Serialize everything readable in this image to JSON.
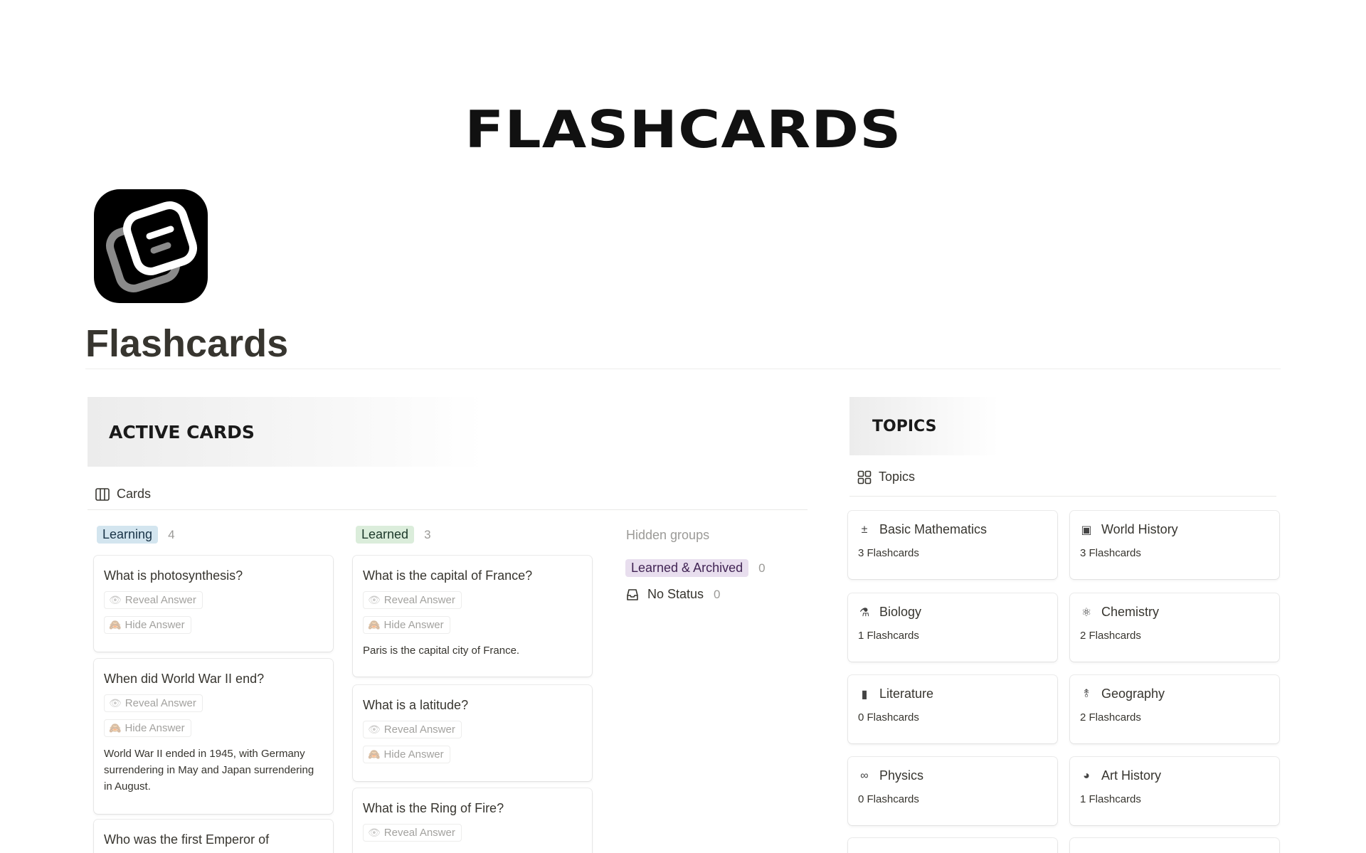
{
  "banner": {
    "title": "FLASHCARDS"
  },
  "page": {
    "title": "Flashcards"
  },
  "active": {
    "header": "ACTIVE CARDS",
    "view_label": "Cards",
    "groups": [
      {
        "label": "Learning",
        "count": "4",
        "bg": "#d3e5ef",
        "color": "#183347"
      },
      {
        "label": "Learned",
        "count": "3",
        "bg": "#dbeddb",
        "color": "#1c3829"
      }
    ],
    "hidden": {
      "label": "Hidden groups",
      "items": [
        {
          "label": "Learned & Archived",
          "count": "0",
          "bg": "#e8deee",
          "color": "#412454"
        },
        {
          "label": "No Status",
          "count": "0"
        }
      ]
    },
    "reveal_label": "Reveal Answer",
    "hide_label": "Hide Answer",
    "cards": [
      {
        "title": "What is photosynthesis?",
        "answer": ""
      },
      {
        "title": "When did World War II end?",
        "answer": "World War II ended in 1945, with Germany surrendering in May and Japan surrendering in August."
      },
      {
        "title": "Who was the first Emperor of",
        "answer": ""
      },
      {
        "title": "What is the capital of France?",
        "answer": "Paris is the capital city of France."
      },
      {
        "title": "What is a latitude?",
        "answer": ""
      },
      {
        "title": "What is the Ring of Fire?",
        "answer": ""
      }
    ]
  },
  "topics": {
    "header": "TOPICS",
    "view_label": "Topics",
    "items": [
      {
        "name": "Basic Mathematics",
        "count": "3 Flashcards",
        "icon": "±"
      },
      {
        "name": "World History",
        "count": "3 Flashcards",
        "icon": "▣"
      },
      {
        "name": "Biology",
        "count": "1 Flashcards",
        "icon": "⚗"
      },
      {
        "name": "Chemistry",
        "count": "2 Flashcards",
        "icon": "⚛"
      },
      {
        "name": "Literature",
        "count": "0 Flashcards",
        "icon": "▮"
      },
      {
        "name": "Geography",
        "count": "2 Flashcards",
        "icon": "⥉"
      },
      {
        "name": "Physics",
        "count": "0 Flashcards",
        "icon": "∞"
      },
      {
        "name": "Art History",
        "count": "1 Flashcards",
        "icon": "◕"
      }
    ]
  }
}
